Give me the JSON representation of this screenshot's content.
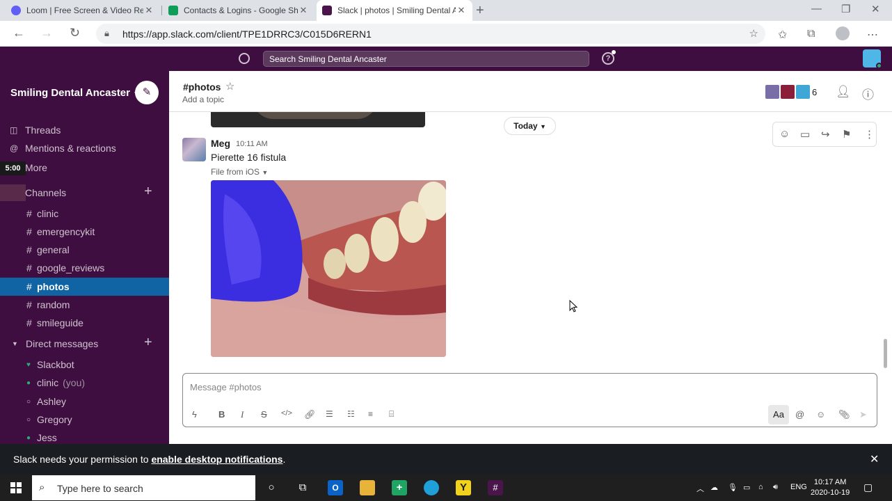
{
  "browser": {
    "tabs": [
      {
        "title": "Loom | Free Screen & Video Rec",
        "favicon_color": "#625df5"
      },
      {
        "title": "Contacts & Logins - Google She",
        "favicon_color": "#0f9d58"
      },
      {
        "title": "Slack | photos | Smiling Dental A",
        "favicon_color": "#4a154b"
      }
    ],
    "url": "https://app.slack.com/client/TPE1DRRC3/C015D6RERN1"
  },
  "slack": {
    "search_placeholder": "Search Smiling Dental Ancaster",
    "workspace": "Smiling Dental Ancaster",
    "timer": "5:00",
    "sidebar": {
      "threads": "Threads",
      "mentions": "Mentions & reactions",
      "more": "More",
      "channels_label": "Channels",
      "channels": [
        "clinic",
        "emergencykit",
        "general",
        "google_reviews",
        "photos",
        "random",
        "smileguide"
      ],
      "active_channel": "photos",
      "dms_label": "Direct messages",
      "dms": [
        {
          "name": "Slackbot",
          "status": "online",
          "suffix": ""
        },
        {
          "name": "clinic",
          "status": "online",
          "suffix": "(you)"
        },
        {
          "name": "Ashley",
          "status": "away",
          "suffix": ""
        },
        {
          "name": "Gregory",
          "status": "away",
          "suffix": ""
        },
        {
          "name": "Jess",
          "status": "online",
          "suffix": ""
        }
      ]
    },
    "channel": {
      "name": "#photos",
      "topic_placeholder": "Add a topic",
      "member_count": "6"
    },
    "messages": {
      "date_divider": "Today",
      "author": "Meg",
      "time": "10:11 AM",
      "text": "Pierette 16 fistula",
      "file_meta": "File from iOS"
    },
    "composer": {
      "placeholder": "Message #photos",
      "format_toggle": "Aa"
    },
    "banner": {
      "text": "Slack needs your permission to",
      "link": "enable desktop notifications",
      "end": "."
    }
  },
  "taskbar": {
    "search_placeholder": "Type here to search",
    "language": "ENG",
    "time": "10:17 AM",
    "date": "2020-10-19"
  }
}
